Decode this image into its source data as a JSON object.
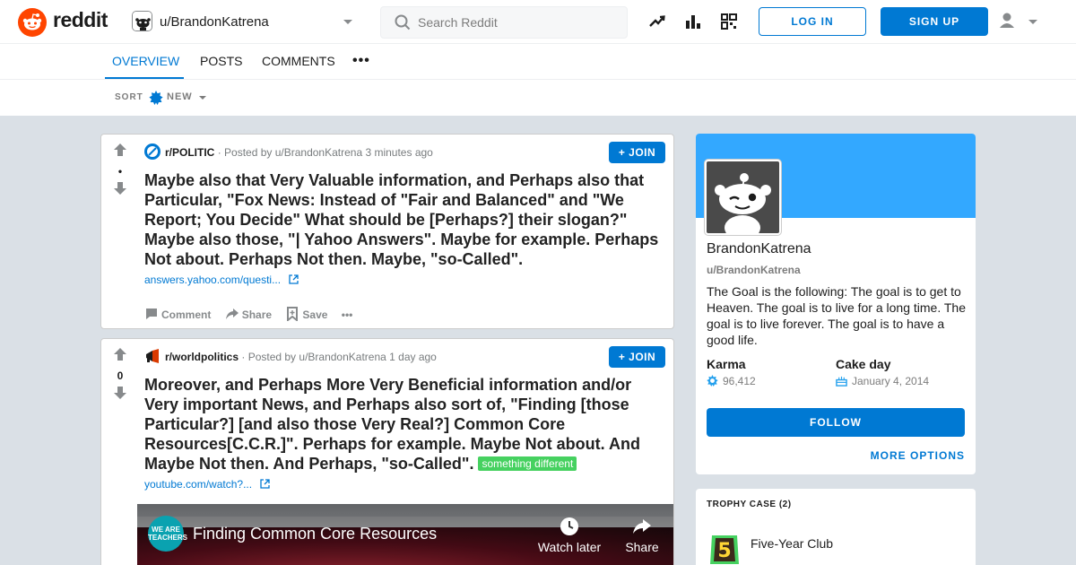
{
  "header": {
    "logo_text": "reddit",
    "profile_switch": "u/BrandonKatrena",
    "search_placeholder": "Search Reddit",
    "login_label": "LOG IN",
    "signup_label": "SIGN UP"
  },
  "tabs": {
    "overview": "OVERVIEW",
    "posts": "POSTS",
    "comments": "COMMENTS",
    "more": "•••"
  },
  "sort": {
    "label": "SORT",
    "value": "NEW"
  },
  "posts": [
    {
      "subreddit": "r/POLITIC",
      "posted_by": "· Posted by u/BrandonKatrena 3 minutes ago",
      "score": "•",
      "join_label": "JOIN",
      "title": "Maybe also that Very Valuable information, and Perhaps also that Particular, \"Fox News: Instead of \"Fair and Balanced\" and \"We Report; You Decide\" What should be [Perhaps?] their slogan?\" Maybe also those, \"| Yahoo Answers\". Maybe for example. Perhaps Not about. Perhaps Not then. Maybe, \"so-Called\".",
      "link": "answers.yahoo.com/questi...",
      "actions": {
        "comment": "Comment",
        "share": "Share",
        "save": "Save",
        "more": "•••"
      }
    },
    {
      "subreddit": "r/worldpolitics",
      "posted_by": "· Posted by u/BrandonKatrena 1 day ago",
      "score": "0",
      "join_label": "JOIN",
      "title": "Moreover, and Perhaps More Very Beneficial information and/or Very important News, and Perhaps also sort of, \"Finding [those Particular?] [and also those Very Real?] Common Core Resources[C.C.R.]\". Perhaps for example. Maybe Not about. And Maybe Not then. And Perhaps, \"so-Called\".",
      "flair": "something different",
      "link": "youtube.com/watch?...",
      "video": {
        "channel": "WE ARE TEACHERS",
        "title": "Finding Common Core Resources",
        "watch_later": "Watch later",
        "share": "Share"
      }
    }
  ],
  "profile": {
    "display_name": "BrandonKatrena",
    "handle": "u/BrandonKatrena",
    "description": "The Goal is the following: The goal is to get to Heaven. The goal is to live for a long time. The goal is to live forever. The goal is to have a good life.",
    "karma_label": "Karma",
    "karma_value": "96,412",
    "cake_label": "Cake day",
    "cake_value": "January 4, 2014",
    "follow_label": "FOLLOW",
    "more_options": "MORE OPTIONS"
  },
  "trophy_case": {
    "heading": "TROPHY CASE (2)",
    "items": [
      {
        "name": "Five-Year Club",
        "badge": "5"
      }
    ]
  },
  "colors": {
    "brand": "#ff4500",
    "accent": "#0079d3",
    "banner": "#33a8ff",
    "flair": "#46d160"
  }
}
